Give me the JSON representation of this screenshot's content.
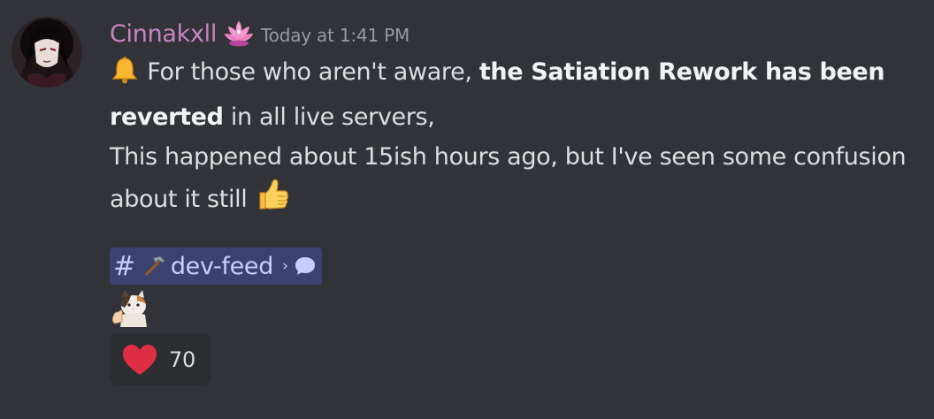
{
  "message": {
    "author": {
      "username": "Cinnakxll",
      "avatar_icon": "avatar-image",
      "role_icon": "pink-lotus-badge-icon",
      "name_color": "#c983c5"
    },
    "timestamp": "Today at 1:41 PM",
    "content": {
      "line1_emoji": "bell-icon",
      "line1_pre": "For those who aren't aware, ",
      "line1_bold": "the Satiation Rework has been",
      "line2_bold": "reverted",
      "line2_post": " in all live servers,",
      "line3": "This happened about 15ish hours ago, but I've seen some confusion",
      "line4": "about it still",
      "line4_emoji": "thumbs-up-icon"
    },
    "channel_mention": {
      "hash": "#",
      "icon": "hammer-icon",
      "name": "dev-feed",
      "chevron": "›",
      "thread_icon": "speech-bubble-icon",
      "color": "#c9cdfb",
      "background": "#3c4270"
    },
    "sticker_emoji": "cat-thumbs-up-icon",
    "reactions": [
      {
        "emoji": "red-heart-icon",
        "count": "70"
      }
    ]
  }
}
